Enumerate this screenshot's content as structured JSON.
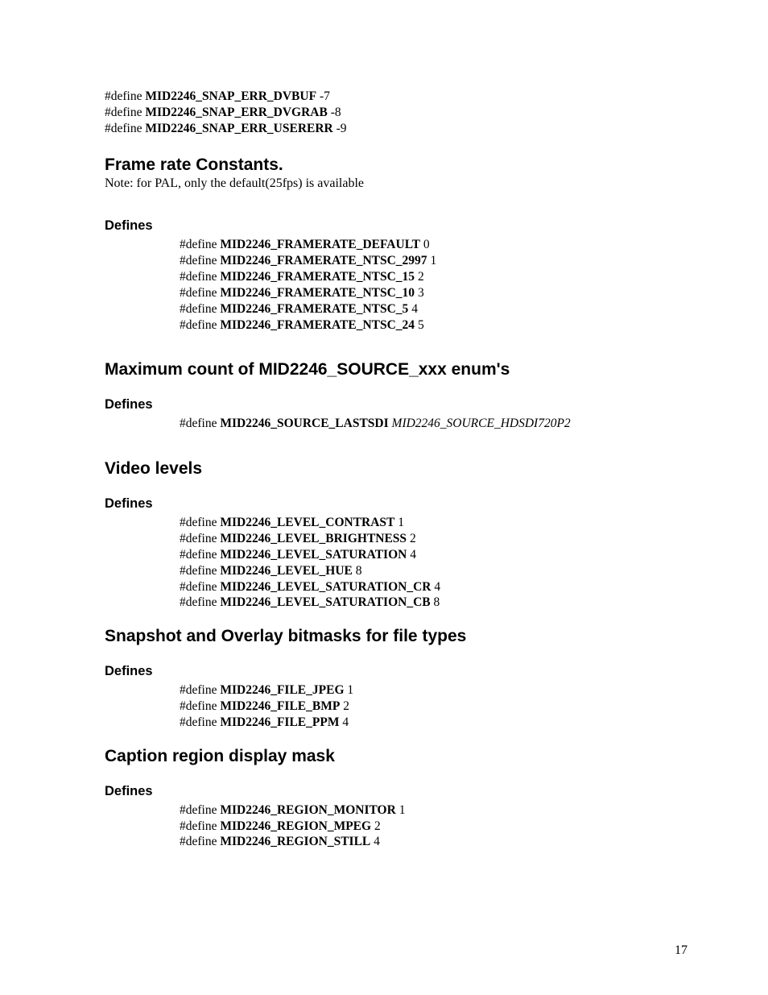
{
  "top_defines": [
    {
      "kw": "#define",
      "name": "MID2246_SNAP_ERR_DVBUF",
      "val": "-7"
    },
    {
      "kw": "#define",
      "name": "MID2246_SNAP_ERR_DVGRAB",
      "val": "-8"
    },
    {
      "kw": "#define",
      "name": "MID2246_SNAP_ERR_USERERR",
      "val": "-9"
    }
  ],
  "sections": [
    {
      "title": "Frame rate Constants.",
      "note": "Note: for PAL, only the default(25fps) is available",
      "defines_label": "Defines",
      "defines": [
        {
          "kw": "#define",
          "name": "MID2246_FRAMERATE_DEFAULT",
          "val": "0"
        },
        {
          "kw": "#define",
          "name": "MID2246_FRAMERATE_NTSC_2997",
          "val": "1"
        },
        {
          "kw": "#define",
          "name": "MID2246_FRAMERATE_NTSC_15",
          "val": "2"
        },
        {
          "kw": "#define",
          "name": "MID2246_FRAMERATE_NTSC_10",
          "val": "3"
        },
        {
          "kw": "#define",
          "name": "MID2246_FRAMERATE_NTSC_5",
          "val": "4"
        },
        {
          "kw": "#define",
          "name": "MID2246_FRAMERATE_NTSC_24",
          "val": "5"
        }
      ]
    },
    {
      "title": "Maximum count of MID2246_SOURCE_xxx enum's",
      "defines_label": "Defines",
      "defines": [
        {
          "kw": "#define",
          "name": "MID2246_SOURCE_LASTSDI",
          "valItalic": "MID2246_SOURCE_HDSDI720P2"
        }
      ]
    },
    {
      "title": "Video levels",
      "defines_label": "Defines",
      "defines": [
        {
          "kw": "#define",
          "name": "MID2246_LEVEL_CONTRAST",
          "val": "1"
        },
        {
          "kw": "#define",
          "name": "MID2246_LEVEL_BRIGHTNESS",
          "val": "2"
        },
        {
          "kw": "#define",
          "name": "MID2246_LEVEL_SATURATION",
          "val": "4"
        },
        {
          "kw": "#define",
          "name": "MID2246_LEVEL_HUE",
          "val": "8"
        },
        {
          "kw": "#define",
          "name": "MID2246_LEVEL_SATURATION_CR",
          "val": "4"
        },
        {
          "kw": "#define",
          "name": "MID2246_LEVEL_SATURATION_CB",
          "val": "8"
        }
      ]
    },
    {
      "title": "Snapshot and Overlay bitmasks for file types",
      "defines_label": "Defines",
      "defines": [
        {
          "kw": "#define",
          "name": "MID2246_FILE_JPEG",
          "val": "1"
        },
        {
          "kw": "#define",
          "name": "MID2246_FILE_BMP",
          "val": "2"
        },
        {
          "kw": "#define",
          "name": "MID2246_FILE_PPM",
          "val": "4"
        }
      ]
    },
    {
      "title": "Caption region display mask",
      "defines_label": "Defines",
      "defines": [
        {
          "kw": "#define",
          "name": "MID2246_REGION_MONITOR",
          "val": "1"
        },
        {
          "kw": "#define",
          "name": "MID2246_REGION_MPEG",
          "val": "2"
        },
        {
          "kw": "#define",
          "name": "MID2246_REGION_STILL",
          "val": "4"
        }
      ]
    }
  ],
  "page_number": "17"
}
